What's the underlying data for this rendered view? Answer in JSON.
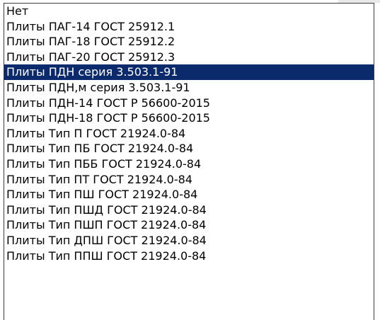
{
  "listbox": {
    "items": [
      {
        "label": "Нет",
        "selected": false
      },
      {
        "label": "Плиты ПАГ-14 ГОСТ 25912.1",
        "selected": false
      },
      {
        "label": "Плиты ПАГ-18 ГОСТ 25912.2",
        "selected": false
      },
      {
        "label": "Плиты ПАГ-20 ГОСТ 25912.3",
        "selected": false
      },
      {
        "label": "Плиты ПДН серия 3.503.1-91",
        "selected": true
      },
      {
        "label": "Плиты ПДН,м серия 3.503.1-91",
        "selected": false
      },
      {
        "label": "Плиты ПДН-14 ГОСТ Р 56600-2015",
        "selected": false
      },
      {
        "label": "Плиты ПДН-18 ГОСТ Р 56600-2015",
        "selected": false
      },
      {
        "label": "Плиты Тип П ГОСТ 21924.0-84",
        "selected": false
      },
      {
        "label": "Плиты Тип ПБ ГОСТ 21924.0-84",
        "selected": false
      },
      {
        "label": "Плиты Тип ПББ ГОСТ 21924.0-84",
        "selected": false
      },
      {
        "label": "Плиты Тип ПТ ГОСТ 21924.0-84",
        "selected": false
      },
      {
        "label": "Плиты Тип ПШ ГОСТ 21924.0-84",
        "selected": false
      },
      {
        "label": "Плиты Тип ПШД ГОСТ 21924.0-84",
        "selected": false
      },
      {
        "label": "Плиты Тип ПШП ГОСТ 21924.0-84",
        "selected": false
      },
      {
        "label": "Плиты Тип ДПШ ГОСТ 21924.0-84",
        "selected": false
      },
      {
        "label": "Плиты Тип ППШ ГОСТ 21924.0-84",
        "selected": false
      }
    ]
  },
  "colors": {
    "selection_background": "#0b2a6b",
    "selection_text": "#ffffff",
    "text": "#000000",
    "border": "#3c3c3c"
  }
}
